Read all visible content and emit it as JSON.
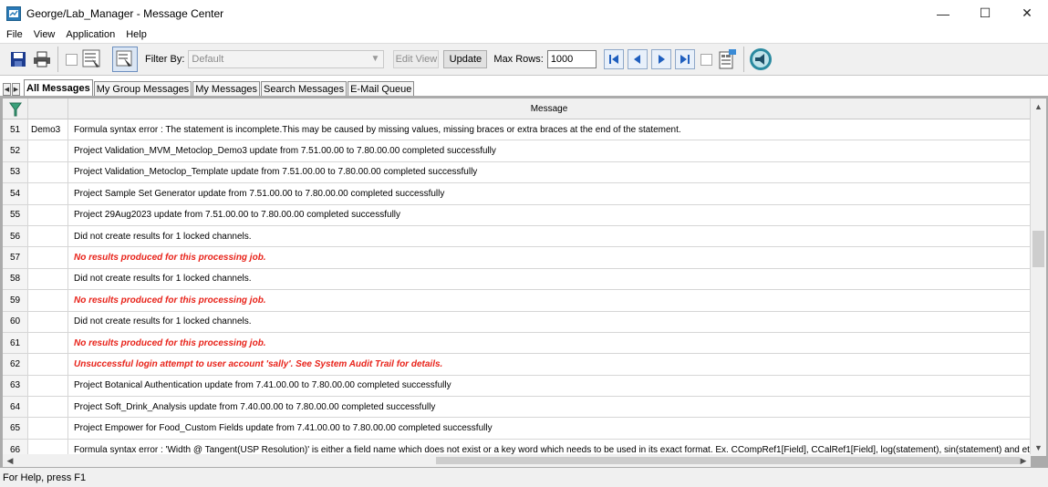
{
  "window": {
    "title": "George/Lab_Manager - Message Center",
    "minimize_glyph": "—",
    "maximize_glyph": "☐",
    "close_glyph": "✕"
  },
  "menu": [
    "File",
    "View",
    "Application",
    "Help"
  ],
  "toolbar": {
    "filter_label": "Filter By:",
    "filter_value": "Default",
    "edit_view_label": "Edit View",
    "update_label": "Update",
    "max_rows_label": "Max Rows:",
    "max_rows_value": "1000",
    "icons": [
      "save-icon",
      "print-icon",
      "view-icon",
      "view-alt-icon",
      "first-icon",
      "previous-icon",
      "next-icon",
      "last-icon",
      "report-icon",
      "announce-icon"
    ]
  },
  "tabs": [
    "All Messages",
    "My Group Messages",
    "My Messages",
    "Search Messages",
    "E-Mail Queue"
  ],
  "grid": {
    "message_header": "Message",
    "rows": [
      {
        "num": "51",
        "source": "Demo3",
        "message": "Formula syntax error : The statement is incomplete.This may be caused by missing values, missing braces or extra braces at the end of the statement.",
        "error": false
      },
      {
        "num": "52",
        "source": "",
        "message": "Project Validation_MVM_Metoclop_Demo3 update from 7.51.00.00 to 7.80.00.00 completed successfully",
        "error": false
      },
      {
        "num": "53",
        "source": "",
        "message": "Project Validation_Metoclop_Template update from 7.51.00.00 to 7.80.00.00 completed successfully",
        "error": false
      },
      {
        "num": "54",
        "source": "",
        "message": "Project Sample Set Generator update from 7.51.00.00 to 7.80.00.00 completed successfully",
        "error": false
      },
      {
        "num": "55",
        "source": "",
        "message": "Project 29Aug2023 update from 7.51.00.00 to 7.80.00.00 completed successfully",
        "error": false
      },
      {
        "num": "56",
        "source": "",
        "message": "Did not create results for 1 locked channels.",
        "error": false
      },
      {
        "num": "57",
        "source": "",
        "message": "No results produced for this processing job.",
        "error": true
      },
      {
        "num": "58",
        "source": "",
        "message": "Did not create results for 1 locked channels.",
        "error": false
      },
      {
        "num": "59",
        "source": "",
        "message": "No results produced for this processing job.",
        "error": true
      },
      {
        "num": "60",
        "source": "",
        "message": "Did not create results for 1 locked channels.",
        "error": false
      },
      {
        "num": "61",
        "source": "",
        "message": "No results produced for this processing job.",
        "error": true
      },
      {
        "num": "62",
        "source": "",
        "message": "Unsuccessful login attempt to user account 'sally'.  See System Audit Trail for details.",
        "error": true
      },
      {
        "num": "63",
        "source": "",
        "message": "Project Botanical Authentication update from 7.41.00.00 to 7.80.00.00 completed successfully",
        "error": false
      },
      {
        "num": "64",
        "source": "",
        "message": "Project Soft_Drink_Analysis update from 7.40.00.00 to 7.80.00.00 completed successfully",
        "error": false
      },
      {
        "num": "65",
        "source": "",
        "message": "Project Empower for Food_Custom Fields update from 7.41.00.00 to 7.80.00.00 completed successfully",
        "error": false
      },
      {
        "num": "66",
        "source": "",
        "message": "Formula syntax error : 'Width @ Tangent(USP Resolution)' is either a field name which does not exist or a key word which needs to be used in its exact format.     Ex.  CCompRef1[Field], CCalRef1[Field], log(statement), sin(statement) and etc.",
        "error": false
      }
    ]
  },
  "status": {
    "text": "For Help, press F1"
  },
  "colors": {
    "error_text": "#e8231a",
    "toolbar_bg": "#f0f0f0",
    "grid_border": "#d6d6d6"
  }
}
